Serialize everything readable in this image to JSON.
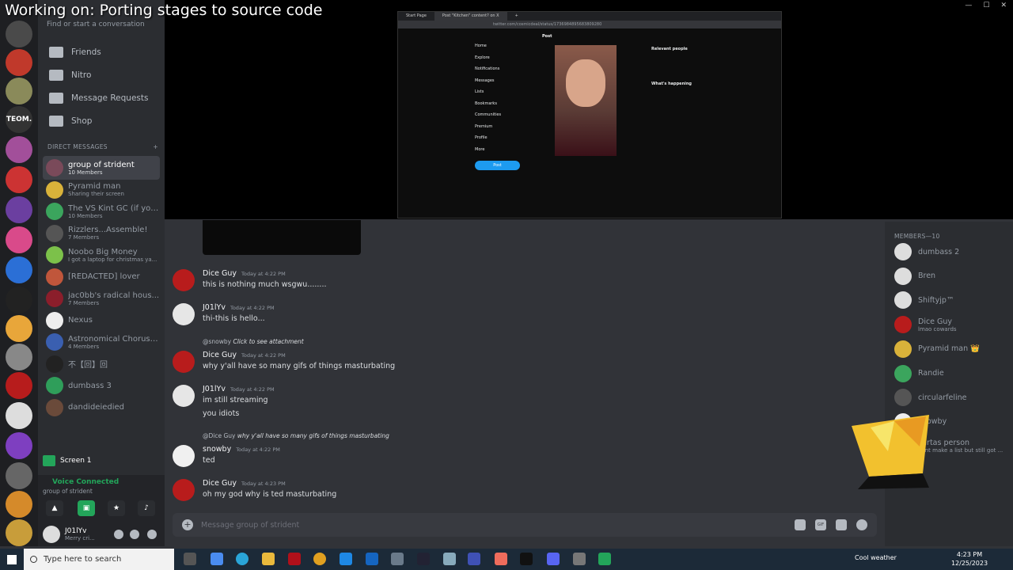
{
  "overlay_title": "Working on: Porting stages to source code",
  "search": {
    "placeholder": "Find or start a conversation"
  },
  "nav": [
    {
      "label": "Friends",
      "icon": "friends-icon"
    },
    {
      "label": "Nitro",
      "icon": "nitro-icon"
    },
    {
      "label": "Message Requests",
      "icon": "mail-icon"
    },
    {
      "label": "Shop",
      "icon": "shop-icon"
    }
  ],
  "dm_header": {
    "label": "DIRECT MESSAGES",
    "add": "+"
  },
  "dms": [
    {
      "name": "group of strident",
      "sub": "10 Members",
      "color": "#7a4a5a",
      "active": true
    },
    {
      "name": "Pyramid man",
      "sub": "Sharing their screen",
      "color": "#d9b23a"
    },
    {
      "name": "The VS Kint GC (if you...",
      "sub": "10 Members",
      "color": "#3ba55d"
    },
    {
      "name": "Rizzlers...Assemble!",
      "sub": "7 Members",
      "color": "#555"
    },
    {
      "name": "Noobo Big Money",
      "sub": "I got a laptop for christmas ya...",
      "color": "#7cc14a"
    },
    {
      "name": "[REDACTED] lover",
      "sub": "",
      "color": "#c0563b"
    },
    {
      "name": "jac0bb's radical hous...",
      "sub": "7 Members",
      "color": "#8b1e2b"
    },
    {
      "name": "Nexus",
      "sub": "",
      "color": "#eee"
    },
    {
      "name": "Astronomical Chorus ...",
      "sub": "4 Members",
      "color": "#3a5fb0"
    },
    {
      "name": "不【回】回",
      "sub": "",
      "color": "#222"
    },
    {
      "name": "dumbass 3",
      "sub": "",
      "color": "#2f9e5a"
    },
    {
      "name": "dandideiedied",
      "sub": "",
      "color": "#6a4a3a"
    }
  ],
  "screen_share": {
    "label": "Screen 1"
  },
  "voice": {
    "status": "Voice Connected",
    "channel": "group of strident"
  },
  "user": {
    "name": "J01lYv",
    "status": "Merry cri..."
  },
  "browser": {
    "tabs": [
      "Start Page",
      "Post \"Kitchen\" content? on X",
      "+"
    ],
    "url": "twitter.com/cosmicdeal/status/1736984895683809280",
    "post_label": "Post",
    "nav": [
      "Home",
      "Explore",
      "Notifications",
      "Messages",
      "Lists",
      "Bookmarks",
      "Communities",
      "Premium",
      "Profile",
      "More"
    ],
    "post_button": "Post",
    "right": {
      "relevant": "Relevant people",
      "happening": "What's happening"
    }
  },
  "messages": [
    {
      "author": "Dice Guy",
      "time": "Today at 4:22 PM",
      "lines": [
        "this is nothing much wsgwu........"
      ],
      "color": "#b81c1c"
    },
    {
      "author": "J01lYv",
      "time": "Today at 4:22 PM",
      "lines": [
        "thi-this is hello..."
      ],
      "color": "#e6e6e6"
    },
    {
      "author": "Dice Guy",
      "time": "Today at 4:22 PM",
      "lines": [
        "why y'all have so many gifs of things masturbating"
      ],
      "color": "#b81c1c",
      "reply": {
        "user": "@snowby",
        "text": "Click to see attachment"
      }
    },
    {
      "author": "J01lYv",
      "time": "Today at 4:22 PM",
      "lines": [
        "im still streaming",
        "you idiots"
      ],
      "color": "#e6e6e6"
    },
    {
      "author": "snowby",
      "time": "Today at 4:22 PM",
      "lines": [
        "ted"
      ],
      "color": "#f0f0f0",
      "reply": {
        "user": "@Dice Guy",
        "text": "why y'all have so many gifs of things masturbating"
      }
    },
    {
      "author": "Dice Guy",
      "time": "Today at 4:23 PM",
      "lines": [
        "oh my god why is ted masturbating"
      ],
      "color": "#b81c1c"
    }
  ],
  "composer": {
    "placeholder": "Message group of strident"
  },
  "members": {
    "header": "MEMBERS—10",
    "list": [
      {
        "name": "dumbass 2",
        "sub": "",
        "color": "#ddd"
      },
      {
        "name": "Bren",
        "sub": "",
        "color": "#ddd"
      },
      {
        "name": "Shiftyjp™",
        "sub": "",
        "color": "#ddd"
      },
      {
        "name": "Dice Guy",
        "sub": "lmao cowards",
        "color": "#b81c1c"
      },
      {
        "name": "Pyramid man 👑",
        "sub": "",
        "color": "#d9b23a"
      },
      {
        "name": "Randie",
        "sub": "",
        "color": "#3ba55d"
      },
      {
        "name": "circularfeline",
        "sub": "",
        "color": "#555"
      },
      {
        "name": "snowby",
        "sub": "",
        "color": "#eee"
      },
      {
        "name": "cartas person",
        "sub": "dont make a list but still got ...",
        "color": "#444"
      }
    ]
  },
  "taskbar": {
    "search": "Type here to search",
    "weather": "Cool weather",
    "time": "4:23 PM",
    "date": "12/25/2023"
  }
}
